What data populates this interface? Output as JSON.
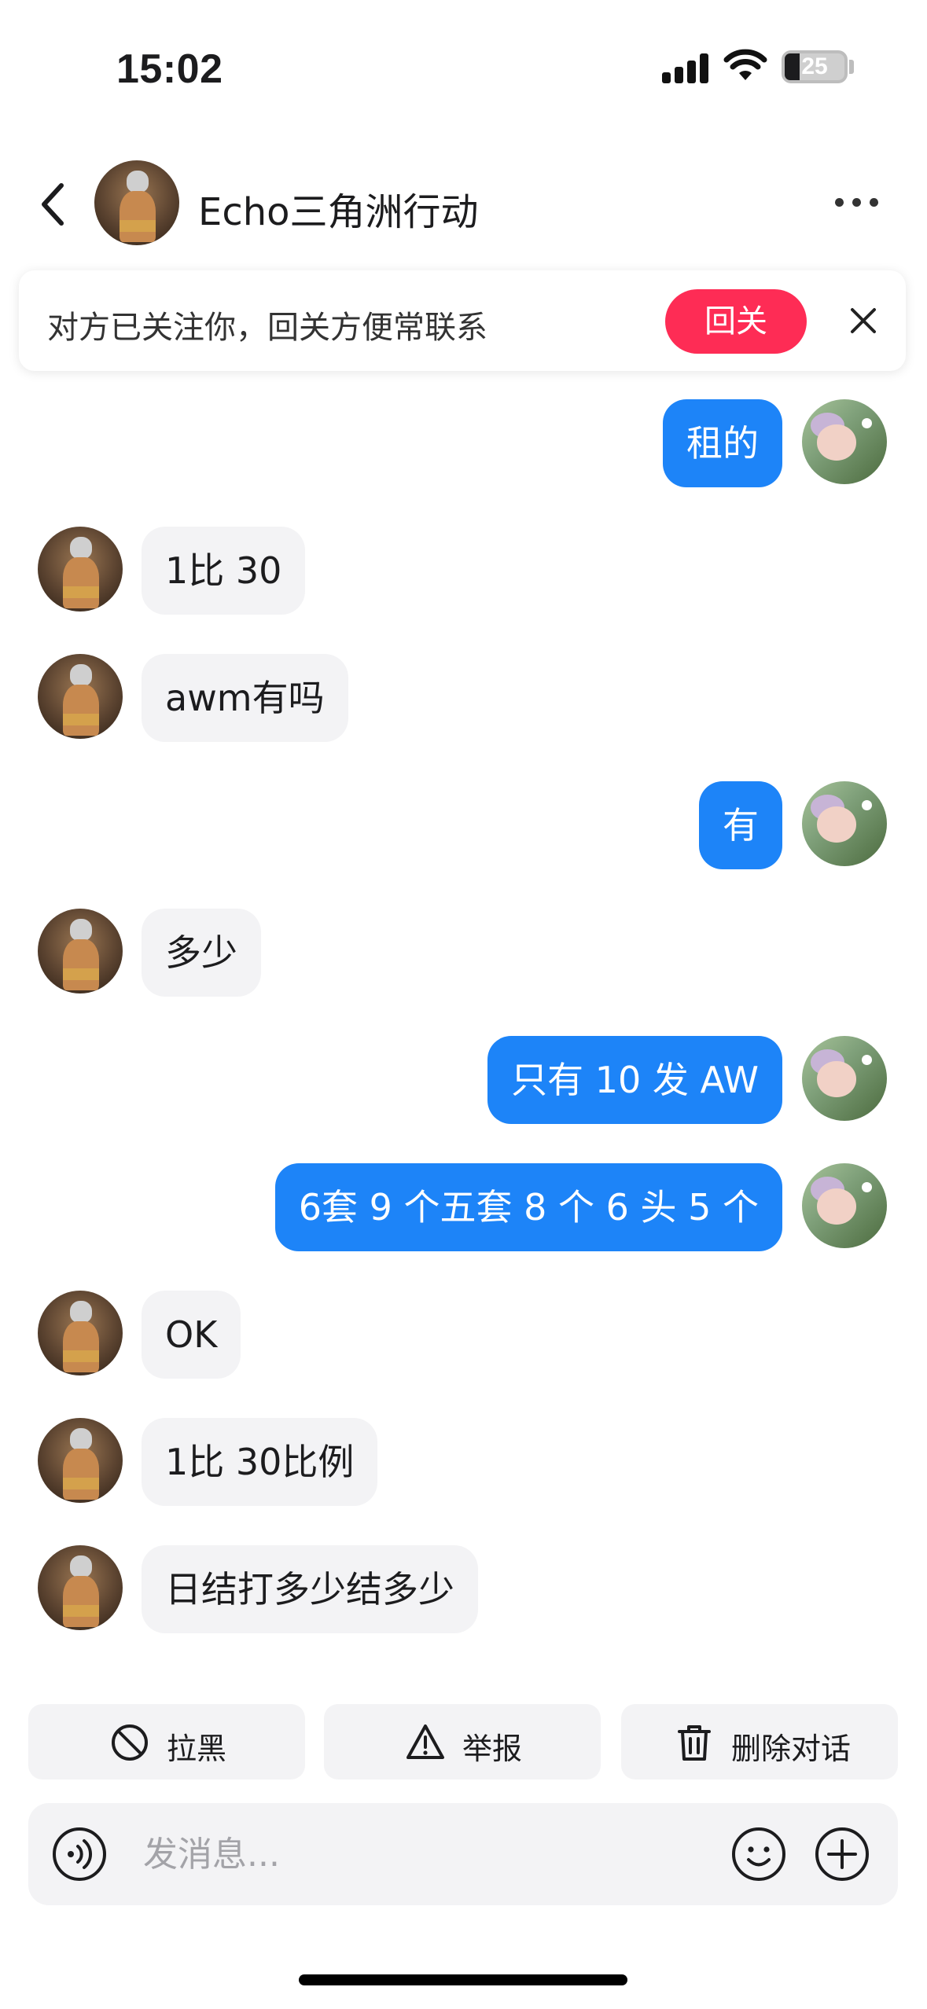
{
  "status_bar": {
    "time": "15:02",
    "battery": "25",
    "battery_level": 0.25
  },
  "header": {
    "title": "Echo三角洲行动"
  },
  "banner": {
    "text": "对方已关注你，回关方便常联系",
    "follow_label": "回关"
  },
  "messages": [
    {
      "from": "me",
      "text": "租的"
    },
    {
      "from": "other",
      "text": "1比 30"
    },
    {
      "from": "other",
      "text": "awm有吗"
    },
    {
      "from": "me",
      "text": "有"
    },
    {
      "from": "other",
      "text": "多少"
    },
    {
      "from": "me",
      "text": "只有 10 发 AW"
    },
    {
      "from": "me",
      "text": "6套 9 个五套 8 个 6 头 5 个"
    },
    {
      "from": "other",
      "text": "OK"
    },
    {
      "from": "other",
      "text": "1比 30比例"
    },
    {
      "from": "other",
      "text": "日结打多少结多少"
    }
  ],
  "actions": {
    "block": "拉黑",
    "report": "举报",
    "delete": "删除对话"
  },
  "composer": {
    "placeholder": "发消息..."
  },
  "colors": {
    "accent_blue": "#1d84f8",
    "follow_red": "#fe2c55",
    "bubble_gray": "#f3f3f5"
  }
}
